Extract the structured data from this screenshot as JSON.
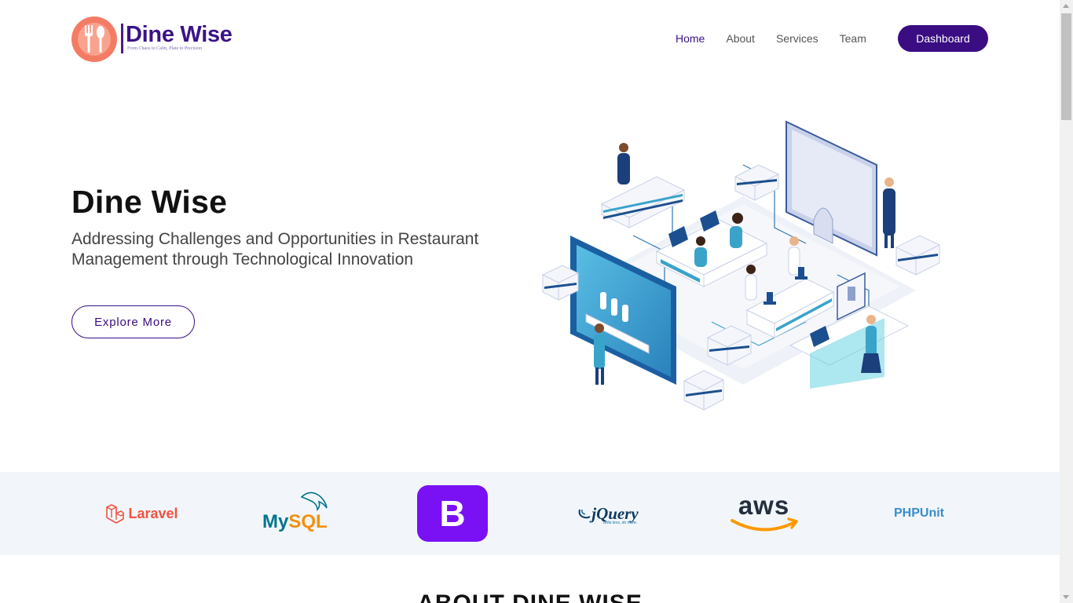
{
  "brand": {
    "name": "Dine Wise",
    "tagline": "From Chaos to Calm, Plate to Precision",
    "color": "#3b1288"
  },
  "nav": {
    "items": [
      "Home",
      "About",
      "Services",
      "Team"
    ],
    "active": "Home",
    "cta": "Dashboard"
  },
  "hero": {
    "title": "Dine Wise",
    "subtitle": "Addressing Challenges and Opportunities in Restaurant Management through Technological Innovation",
    "button": "Explore More"
  },
  "tech_logos": {
    "laravel": "Laravel",
    "mysql_my": "My",
    "mysql_sql": "SQL",
    "bootstrap": "B",
    "jquery": "jQuery",
    "jquery_tag": "write less, do more.",
    "aws": "aws",
    "phpunit": "PHPUnit"
  },
  "about": {
    "heading": "ABOUT DINE WISE"
  },
  "colors": {
    "primary": "#3a0d82",
    "logo_orange": "#f47c64",
    "strip_bg": "#f2f6fa"
  }
}
